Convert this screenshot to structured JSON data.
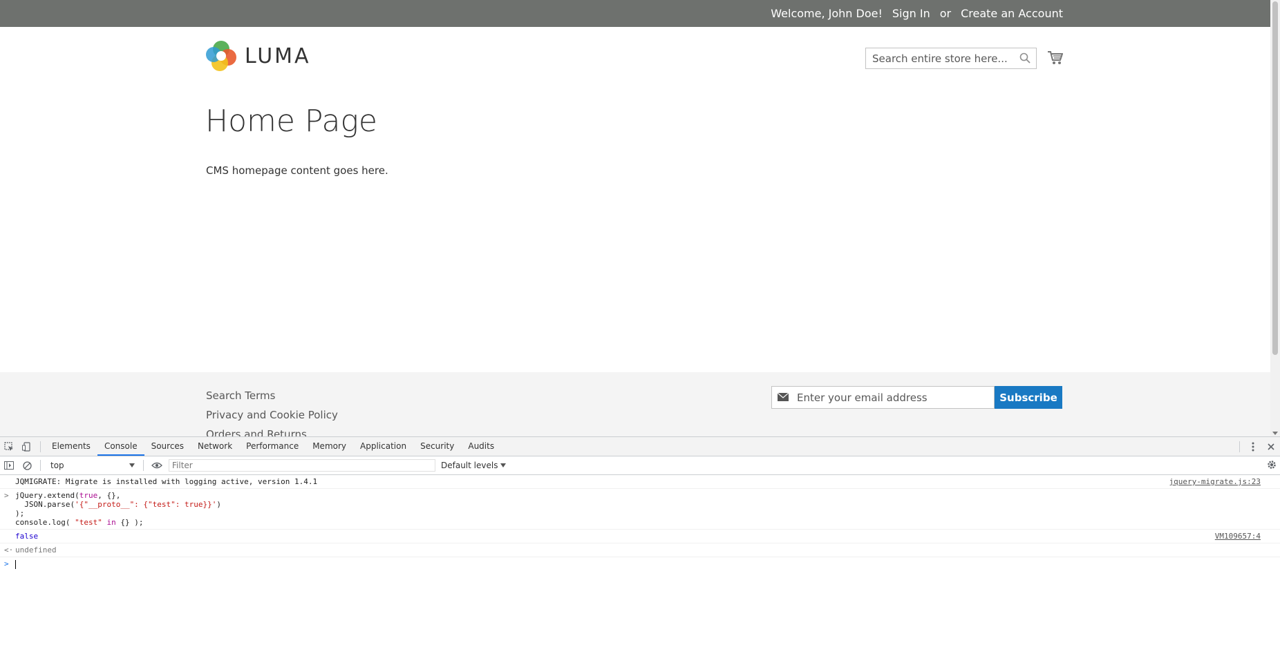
{
  "topbar": {
    "welcome": "Welcome, John Doe!",
    "sign_in": "Sign In",
    "or": "or",
    "create_account": "Create an Account"
  },
  "header": {
    "logo_text": "LUMA",
    "search_placeholder": "Search entire store here..."
  },
  "main": {
    "title": "Home Page",
    "content": "CMS homepage content goes here."
  },
  "footer": {
    "links": [
      "Search Terms",
      "Privacy and Cookie Policy",
      "Orders and Returns"
    ],
    "newsletter_placeholder": "Enter your email address",
    "subscribe_label": "Subscribe"
  },
  "devtools": {
    "tabs": [
      "Elements",
      "Console",
      "Sources",
      "Network",
      "Performance",
      "Memory",
      "Application",
      "Security",
      "Audits"
    ],
    "active_tab": "Console",
    "context": "top",
    "filter_placeholder": "Filter",
    "levels": "Default levels",
    "console": {
      "migrate_msg": "JQMIGRATE: Migrate is installed with logging active, version 1.4.1",
      "migrate_src": "jquery-migrate.js:23",
      "input_line1_a": "jQuery.extend(",
      "input_line1_kw": "true",
      "input_line1_b": ", {},",
      "input_line2_a": "  JSON.parse(",
      "input_line2_str": "'{\"__proto__\": {\"test\": true}}'",
      "input_line2_b": ")",
      "input_line3": ");",
      "input_line4_a": "console.log( ",
      "input_line4_str": "\"test\"",
      "input_line4_kw": "in",
      "input_line4_b": " {} );",
      "output_false": "false",
      "output_src": "VM109657:4",
      "return_value": "undefined"
    }
  },
  "colors": {
    "topbar_bg": "#6e716e",
    "subscribe_bg": "#1979c3",
    "footer_bg": "#f4f4f4",
    "devtools_accent": "#1a73e8"
  }
}
